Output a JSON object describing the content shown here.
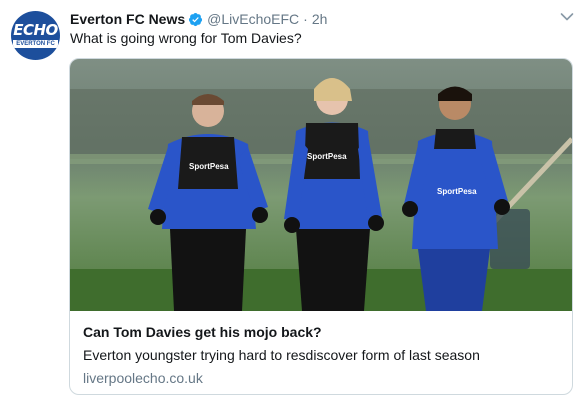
{
  "tweet": {
    "avatar": {
      "logo_top": "ECHO",
      "logo_bottom": "EVERTON FC",
      "color": "#1d4f9c"
    },
    "author_name": "Everton FC News",
    "verified": true,
    "handle": "@LivEchoEFC",
    "separator": "·",
    "timestamp": "2h",
    "text": "What is going wrong for Tom Davies?",
    "more_icon": "chevron-down-icon"
  },
  "card": {
    "photo_alt": "Three Everton players jogging in blue training kit",
    "shirt_sponsor": "SportPesa",
    "title": "Can Tom Davies get his mojo back?",
    "description": "Everton youngster trying hard to resdiscover form of last season",
    "domain": "liverpoolecho.co.uk"
  },
  "colors": {
    "verified_blue": "#1da1f2",
    "secondary_text": "#657786",
    "kit_blue": "#2a55c9"
  }
}
